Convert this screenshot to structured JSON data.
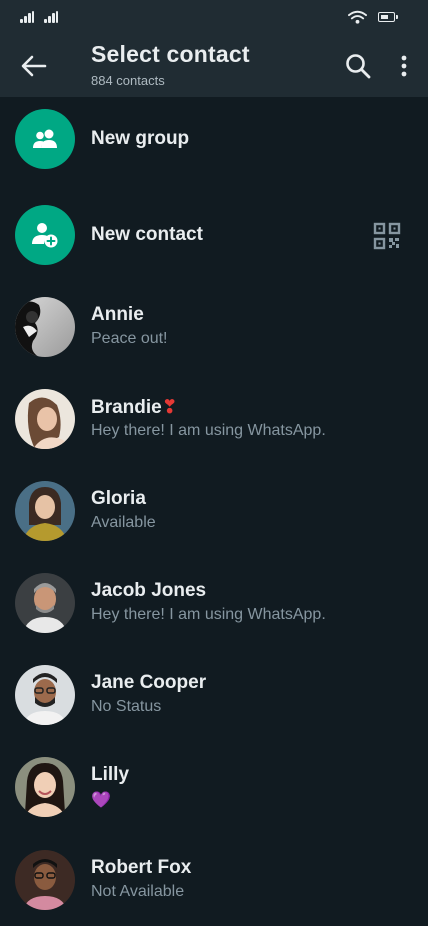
{
  "header": {
    "title": "Select contact",
    "subtitle": "884 contacts"
  },
  "actions": [
    {
      "label": "New group",
      "icon": "group-icon"
    },
    {
      "label": "New contact",
      "icon": "add-contact-icon",
      "extra_icon": "qr-code-icon"
    }
  ],
  "contacts": [
    {
      "name": "Annie",
      "status": "Peace out!"
    },
    {
      "name": "Brandie",
      "status": "Hey there! I am using WhatsApp.",
      "name_emoji": "❣"
    },
    {
      "name": "Gloria",
      "status": "Available"
    },
    {
      "name": "Jacob Jones",
      "status": "Hey there! I am using WhatsApp."
    },
    {
      "name": "Jane Cooper",
      "status": "No Status"
    },
    {
      "name": "Lilly",
      "status": "💜"
    },
    {
      "name": "Robert Fox",
      "status": "Not Available"
    }
  ],
  "colors": {
    "background": "#111b21",
    "appbar": "#202c33",
    "accent": "#00a884",
    "primary_text": "#e9edef",
    "secondary_text": "#8696a0"
  }
}
